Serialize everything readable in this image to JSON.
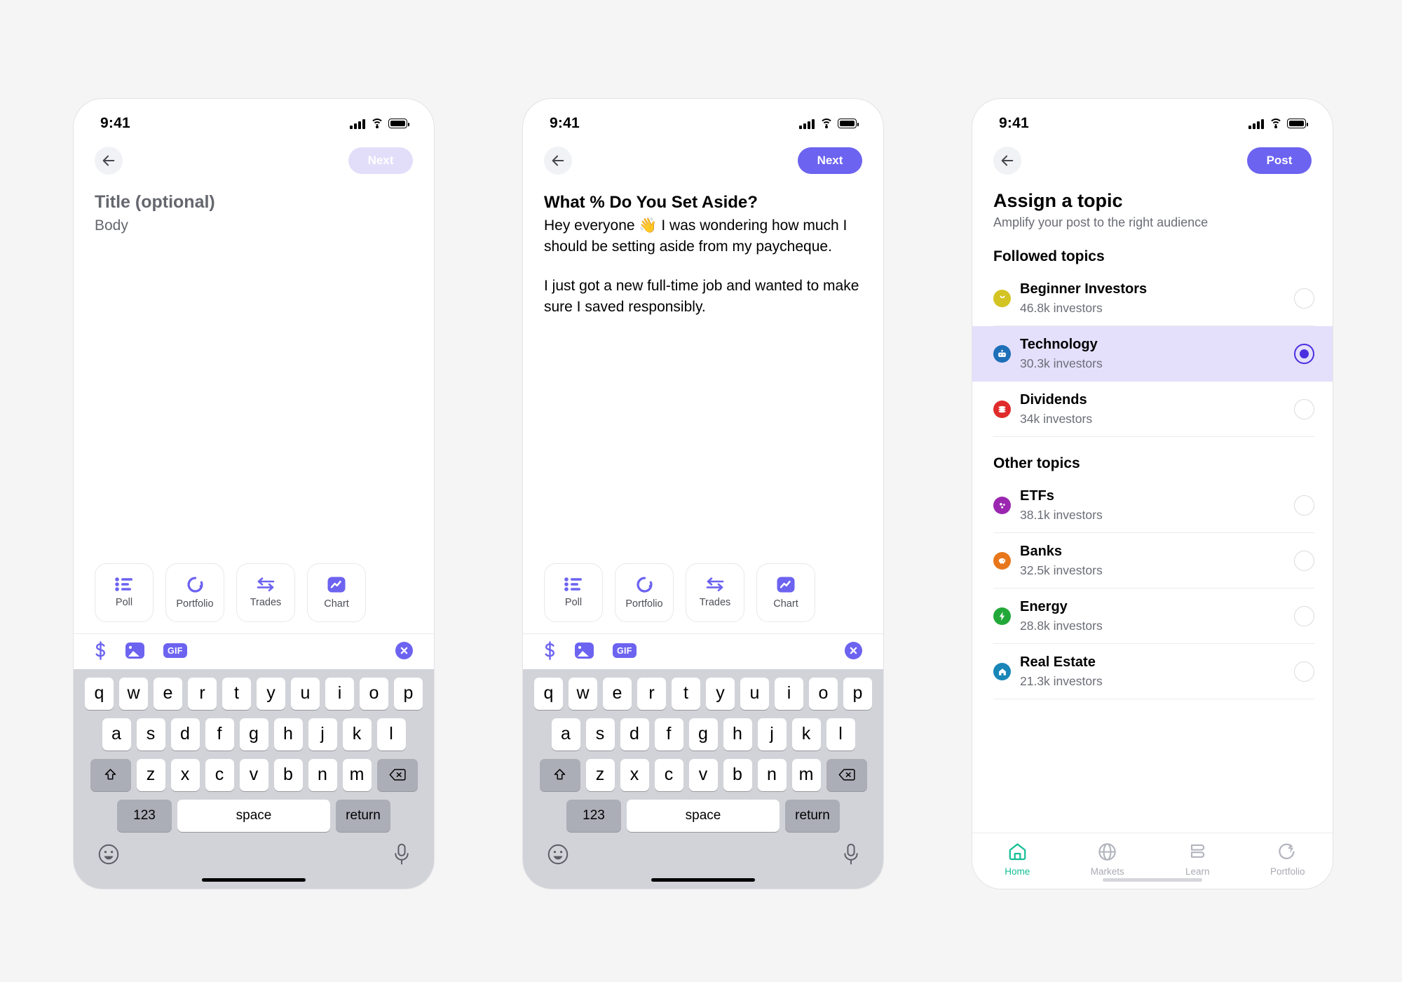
{
  "colors": {
    "accent_purple": "#6c63f0",
    "accent_purple_dark": "#4a2fe0",
    "selected_row_bg": "#e4dffb",
    "disabled_btn_bg": "#e2defa",
    "tab_active_green": "#14bf96",
    "keyboard_bg": "#d1d3d9"
  },
  "status_bar": {
    "time": "9:41"
  },
  "screen_compose_empty": {
    "back_label": "Back",
    "next_label": "Next",
    "next_enabled": false,
    "title_placeholder": "Title (optional)",
    "body_placeholder": "Body"
  },
  "screen_compose_filled": {
    "back_label": "Back",
    "next_label": "Next",
    "next_enabled": true,
    "post_title": "What % Do You Set Aside?",
    "body_paragraph_1": "Hey everyone 👋 I was wondering how much I should be setting aside from my paycheque.",
    "body_paragraph_2": "I just got a new full-time job and wanted to make sure I saved responsibly."
  },
  "attachment_chips": [
    {
      "label": "Poll",
      "icon": "poll-list-icon"
    },
    {
      "label": "Portfolio",
      "icon": "donut-chart-icon"
    },
    {
      "label": "Trades",
      "icon": "swap-arrows-icon"
    },
    {
      "label": "Chart",
      "icon": "line-chart-icon"
    }
  ],
  "media_bar": {
    "dollar_icon": "dollar-sign-icon",
    "image_icon": "image-icon",
    "gif_label": "GIF",
    "close_icon": "close-circle-icon"
  },
  "keyboard": {
    "row1": [
      "q",
      "w",
      "e",
      "r",
      "t",
      "y",
      "u",
      "i",
      "o",
      "p"
    ],
    "row2": [
      "a",
      "s",
      "d",
      "f",
      "g",
      "h",
      "j",
      "k",
      "l"
    ],
    "row3": [
      "z",
      "x",
      "c",
      "v",
      "b",
      "n",
      "m"
    ],
    "shift_icon": "shift-arrow-icon",
    "backspace_icon": "backspace-icon",
    "numeric_label": "123",
    "space_label": "space",
    "return_label": "return",
    "emoji_icon": "emoji-smiley-icon",
    "mic_icon": "microphone-icon"
  },
  "screen_topics": {
    "back_label": "Back",
    "post_label": "Post",
    "title": "Assign a topic",
    "subtitle": "Amplify your post to the right audience",
    "section_followed": "Followed topics",
    "section_other": "Other topics",
    "followed_topics": [
      {
        "name": "Beginner Investors",
        "investors": "46.8k investors",
        "icon": "sprout-icon",
        "icon_color": "#d4c423",
        "selected": false
      },
      {
        "name": "Technology",
        "investors": "30.3k investors",
        "icon": "robot-icon",
        "icon_color": "#1d6fb8",
        "selected": true
      },
      {
        "name": "Dividends",
        "investors": "34k investors",
        "icon": "coins-stack-icon",
        "icon_color": "#e02b2b",
        "selected": false
      }
    ],
    "other_topics": [
      {
        "name": "ETFs",
        "investors": "38.1k investors",
        "icon": "pie-dots-icon",
        "icon_color": "#9b27b0",
        "selected": false
      },
      {
        "name": "Banks",
        "investors": "32.5k investors",
        "icon": "piggy-bank-icon",
        "icon_color": "#e8771b",
        "selected": false
      },
      {
        "name": "Energy",
        "investors": "28.8k investors",
        "icon": "lightning-bolt-icon",
        "icon_color": "#22a838",
        "selected": false
      },
      {
        "name": "Real Estate",
        "investors": "21.3k investors",
        "icon": "house-icon",
        "icon_color": "#1a86b8",
        "selected": false
      }
    ],
    "tabs": [
      {
        "label": "Home",
        "icon": "home-icon",
        "active": true
      },
      {
        "label": "Markets",
        "icon": "globe-icon",
        "active": false
      },
      {
        "label": "Learn",
        "icon": "books-icon",
        "active": false
      },
      {
        "label": "Portfolio",
        "icon": "portfolio-bolt-icon",
        "active": false
      }
    ]
  }
}
